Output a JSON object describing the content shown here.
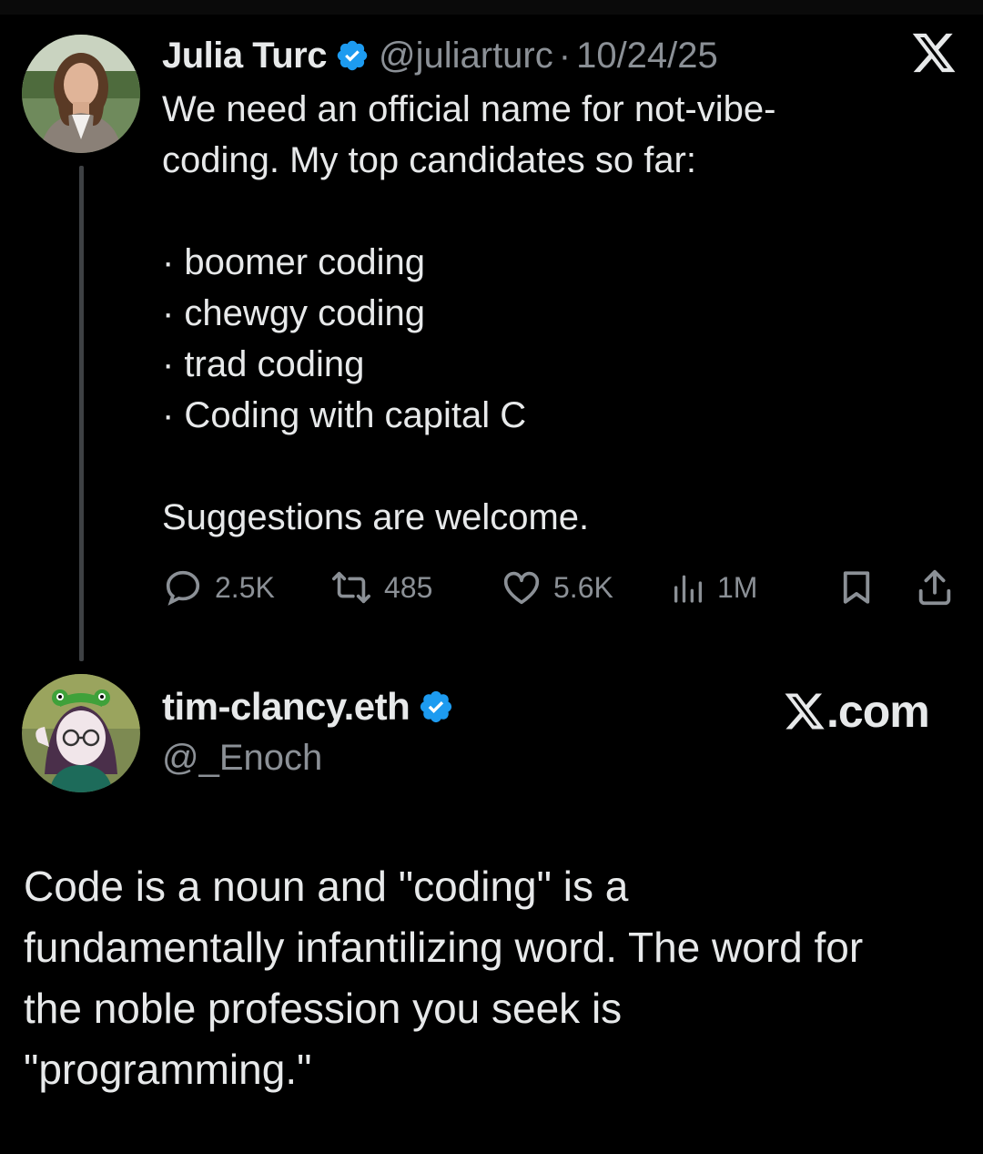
{
  "tweet": {
    "author_name": "Julia Turc",
    "handle": "@juliarturc",
    "separator": "·",
    "date": "10/24/25",
    "lines": [
      "We need an official name for not-vibe-",
      "coding. My top candidates so far:"
    ],
    "list_items": [
      "· boomer coding",
      "· chewgy coding",
      "· trad coding",
      "· Coding with capital C"
    ],
    "closing": "Suggestions are welcome.",
    "stats": {
      "replies": "2.5K",
      "reposts": "485",
      "likes": "5.6K",
      "views": "1M"
    }
  },
  "reply": {
    "author_name": "tim-clancy.eth",
    "handle": "@_Enoch",
    "brand": ".com",
    "lines": [
      "Code is a noun and \"coding\" is a",
      "fundamentally infantilizing word. The word for",
      "the noble profession you seek is",
      "\"programming.\""
    ]
  },
  "colors": {
    "background": "#000000",
    "text": "#e7e9ea",
    "muted": "#8b9096",
    "verified": "#1d9bf0"
  },
  "icons": [
    "x-logo-icon",
    "verified-badge-icon",
    "reply-icon",
    "repost-icon",
    "like-icon",
    "views-icon",
    "bookmark-icon",
    "share-icon"
  ]
}
